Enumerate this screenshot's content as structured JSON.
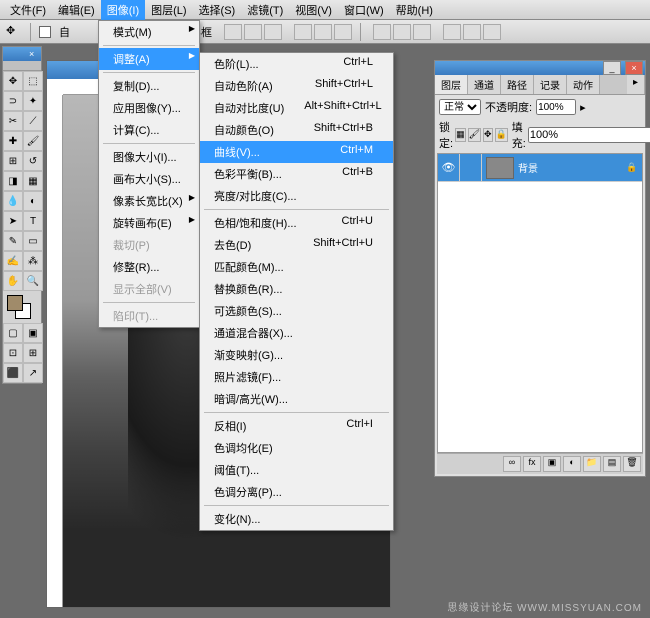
{
  "menubar": {
    "items": [
      {
        "label": "文件(F)",
        "key": "F"
      },
      {
        "label": "编辑(E)",
        "key": "E"
      },
      {
        "label": "图像(I)",
        "key": "I",
        "active": true
      },
      {
        "label": "图层(L)",
        "key": "L"
      },
      {
        "label": "选择(S)",
        "key": "S"
      },
      {
        "label": "滤镜(T)",
        "key": "T"
      },
      {
        "label": "视图(V)",
        "key": "V"
      },
      {
        "label": "窗口(W)",
        "key": "W"
      },
      {
        "label": "帮助(H)",
        "key": "H"
      }
    ]
  },
  "optionsbar": {
    "auto_checkbox_label": "自",
    "bounds_label": "示定界框"
  },
  "image_menu": {
    "items": [
      {
        "label": "模式(M)",
        "submenu": true
      },
      {
        "sep": true
      },
      {
        "label": "调整(A)",
        "submenu": true,
        "highlighted": true
      },
      {
        "sep": true
      },
      {
        "label": "复制(D)...",
        "submenu": false
      },
      {
        "label": "应用图像(Y)...",
        "submenu": false
      },
      {
        "label": "计算(C)...",
        "submenu": false
      },
      {
        "sep": true
      },
      {
        "label": "图像大小(I)...",
        "submenu": false
      },
      {
        "label": "画布大小(S)...",
        "submenu": false
      },
      {
        "label": "像素长宽比(X)",
        "submenu": true
      },
      {
        "label": "旋转画布(E)",
        "submenu": true
      },
      {
        "label": "裁切(P)",
        "disabled": true
      },
      {
        "label": "修整(R)...",
        "submenu": false
      },
      {
        "label": "显示全部(V)",
        "disabled": true
      },
      {
        "sep": true
      },
      {
        "label": "陷印(T)...",
        "disabled": true
      }
    ]
  },
  "adjust_menu": {
    "items": [
      {
        "label": "色阶(L)...",
        "shortcut": "Ctrl+L"
      },
      {
        "label": "自动色阶(A)",
        "shortcut": "Shift+Ctrl+L"
      },
      {
        "label": "自动对比度(U)",
        "shortcut": "Alt+Shift+Ctrl+L"
      },
      {
        "label": "自动颜色(O)",
        "shortcut": "Shift+Ctrl+B"
      },
      {
        "label": "曲线(V)...",
        "shortcut": "Ctrl+M",
        "highlighted": true
      },
      {
        "label": "色彩平衡(B)...",
        "shortcut": "Ctrl+B"
      },
      {
        "label": "亮度/对比度(C)...",
        "shortcut": ""
      },
      {
        "sep": true
      },
      {
        "label": "色相/饱和度(H)...",
        "shortcut": "Ctrl+U"
      },
      {
        "label": "去色(D)",
        "shortcut": "Shift+Ctrl+U"
      },
      {
        "label": "匹配颜色(M)...",
        "shortcut": ""
      },
      {
        "label": "替换颜色(R)...",
        "shortcut": ""
      },
      {
        "label": "可选颜色(S)...",
        "shortcut": ""
      },
      {
        "label": "通道混合器(X)...",
        "shortcut": ""
      },
      {
        "label": "渐变映射(G)...",
        "shortcut": ""
      },
      {
        "label": "照片滤镜(F)...",
        "shortcut": ""
      },
      {
        "label": "暗调/高光(W)...",
        "shortcut": ""
      },
      {
        "sep": true
      },
      {
        "label": "反相(I)",
        "shortcut": "Ctrl+I"
      },
      {
        "label": "色调均化(E)",
        "shortcut": ""
      },
      {
        "label": "阈值(T)...",
        "shortcut": ""
      },
      {
        "label": "色调分离(P)...",
        "shortcut": ""
      },
      {
        "sep": true
      },
      {
        "label": "变化(N)...",
        "shortcut": ""
      }
    ]
  },
  "tools": [
    "move",
    "marquee",
    "lasso",
    "wand",
    "crop",
    "slice",
    "heal",
    "brush",
    "stamp",
    "history",
    "eraser",
    "gradient",
    "blur",
    "dodge",
    "path",
    "type",
    "pen",
    "shape",
    "notes",
    "eyedrop",
    "hand",
    "zoom"
  ],
  "colors": {
    "fg": "#a08b6a",
    "bg": "#ffffff"
  },
  "layers_panel": {
    "tabs": [
      "图层",
      "通道",
      "路径",
      "记录",
      "动作"
    ],
    "active_tab": 0,
    "blend_mode": "正常",
    "opacity_label": "不透明度:",
    "opacity_value": "100%",
    "lock_label": "锁定:",
    "fill_label": "填充:",
    "fill_value": "100%",
    "layers": [
      {
        "name": "背景",
        "visible": true,
        "locked": true,
        "selected": true
      }
    ]
  },
  "watermark": "思缘设计论坛   WWW.MISSYUAN.COM"
}
